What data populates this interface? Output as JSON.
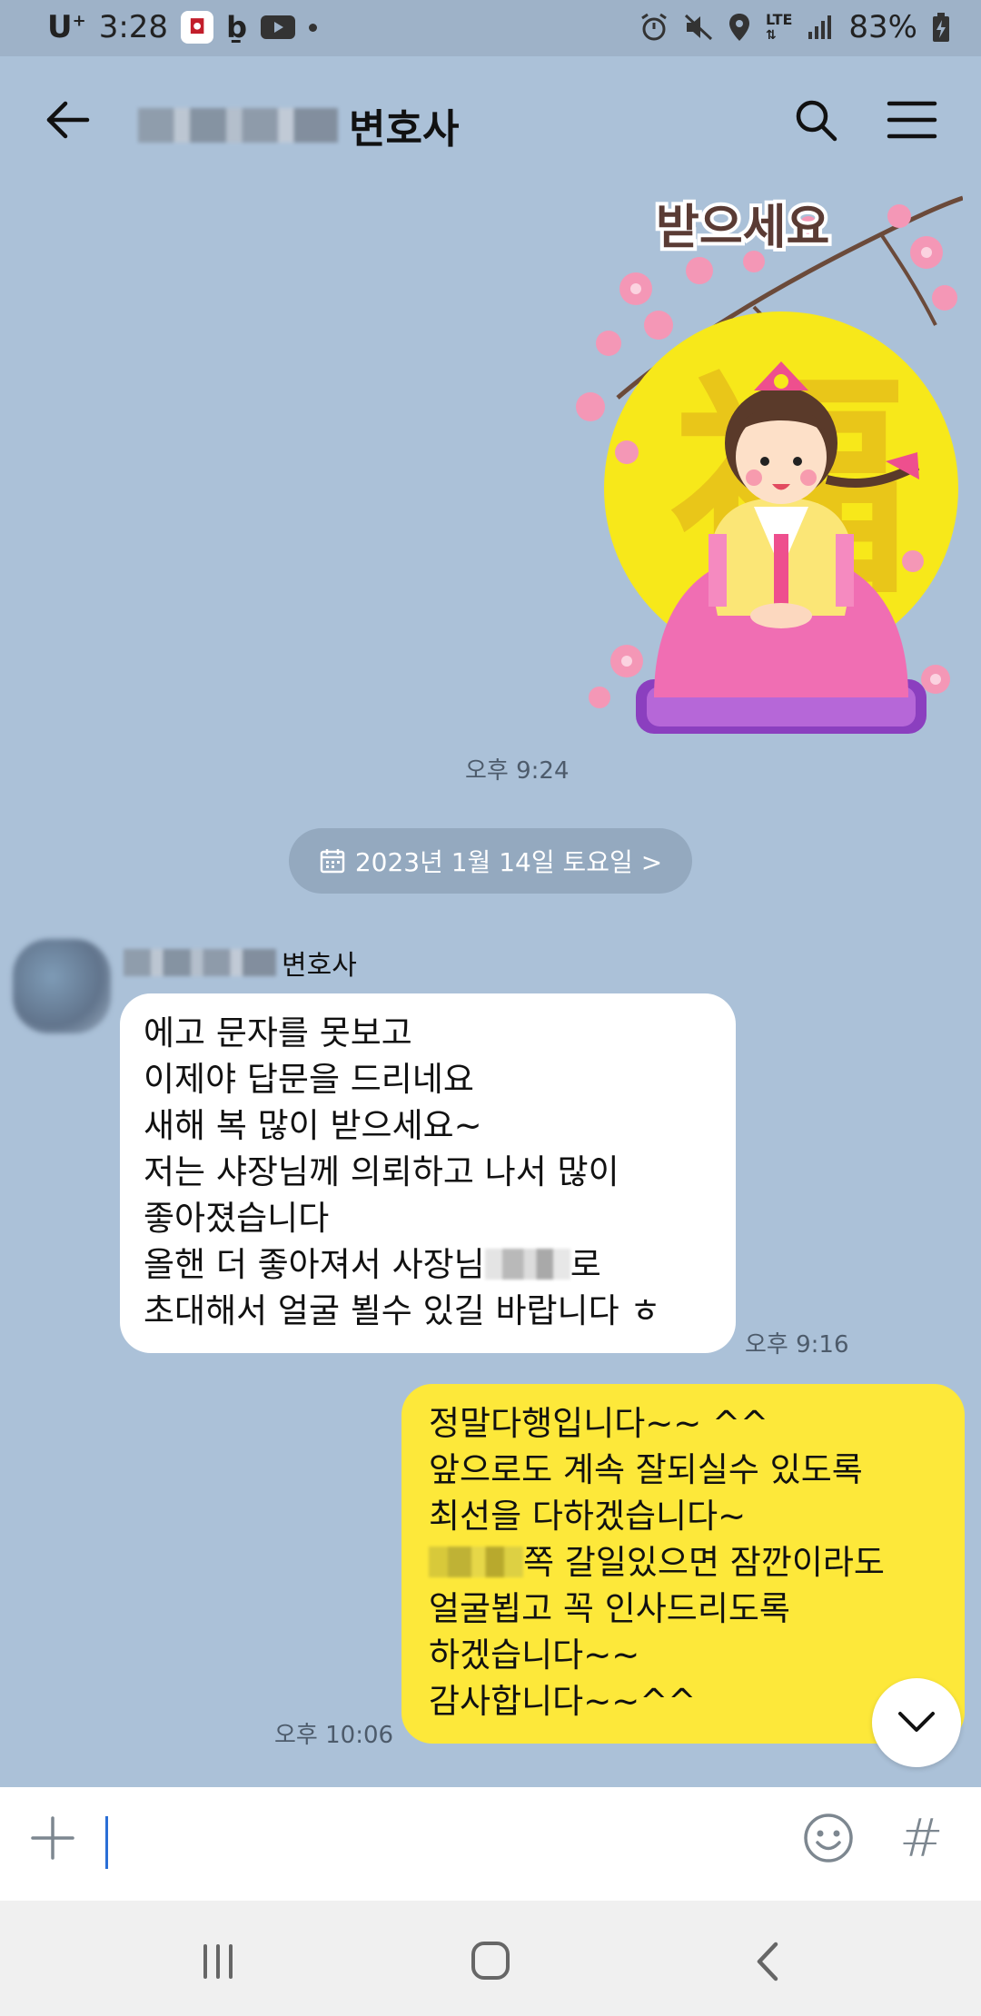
{
  "status_bar": {
    "carrier": "U",
    "carrier_sup": "+",
    "time": "3:28",
    "network": "LTE",
    "battery": "83%"
  },
  "header": {
    "title_suffix": "변호사"
  },
  "messages": {
    "sticker_text": "받으세요",
    "sticker_time": "오후 9:24",
    "date_divider": "2023년 1월 14일 토요일 >",
    "incoming": {
      "sender_suffix": "변호사",
      "lines": [
        "에고 문자를 못보고",
        "이제야 답문을 드리네요",
        "새해 복 많이 받으세요~",
        "저는 샤장님께 의뢰하고 나서 많이",
        "좋아졌습니다",
        "올핸 더 좋아져서 사장님",
        "로",
        "초대해서 얼굴 뵐수 있길 바랍니다 ㅎ"
      ],
      "time": "오후 9:16"
    },
    "outgoing": {
      "lines": [
        "정말다행입니다~~ ^^",
        "앞으로도 계속 잘되실수 있도록",
        "최선을 다하겠습니다~",
        "쪽 갈일있으면 잠깐이라도",
        "얼굴뵙고 꼭 인사드리도록",
        "하겠습니다~~",
        "감사합니다~~^^"
      ],
      "time": "오후 10:06"
    }
  },
  "input": {
    "placeholder": "",
    "hash_label": "#"
  },
  "colors": {
    "background": "#abc1d8",
    "outgoing_bubble": "#fde83a",
    "incoming_bubble": "#ffffff",
    "date_pill": "#94a9bf"
  }
}
